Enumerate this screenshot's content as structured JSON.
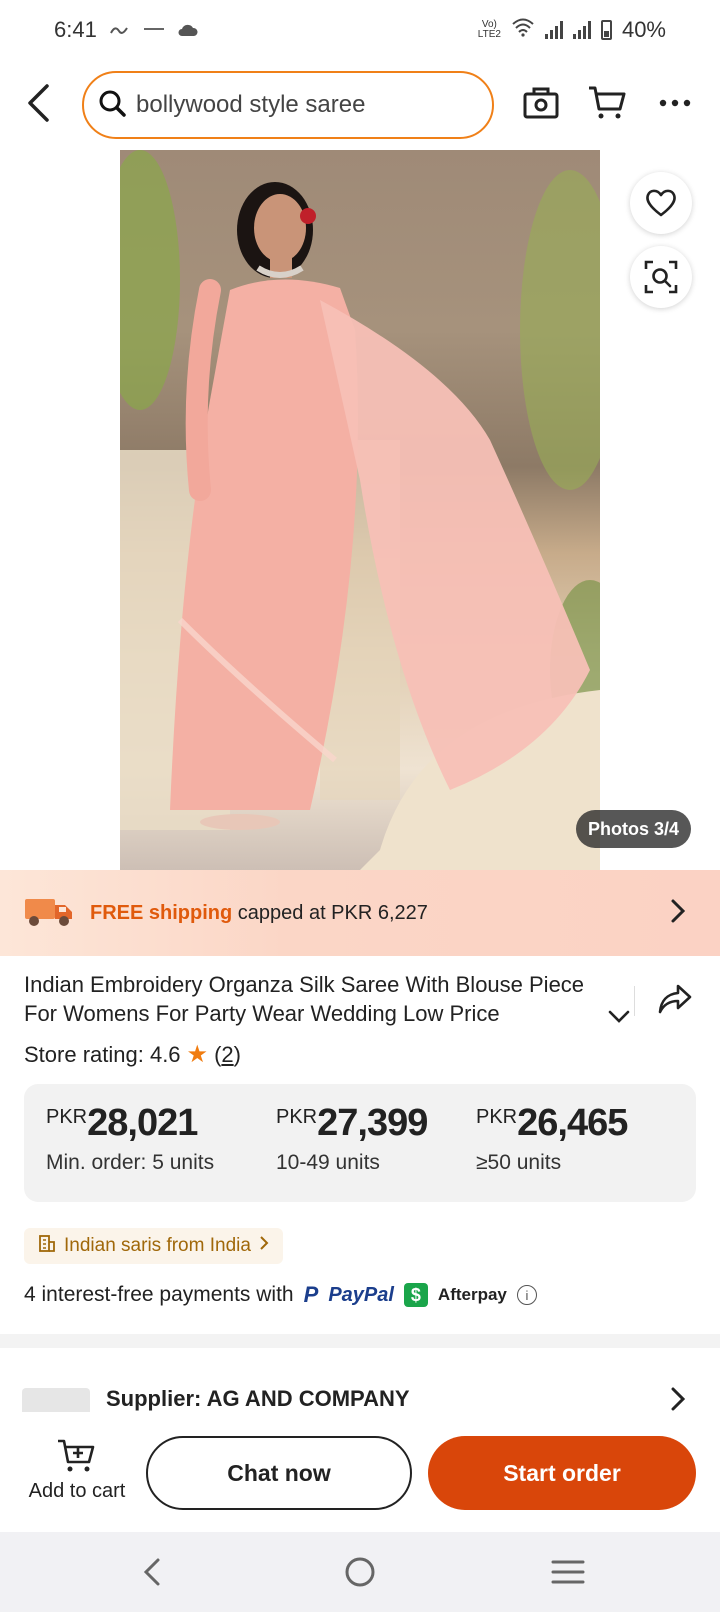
{
  "status_bar": {
    "time": "6:41",
    "battery": "40%",
    "net_label": "LTE2"
  },
  "search": {
    "query": "bollywood style saree"
  },
  "gallery": {
    "photo_counter": "Photos 3/4"
  },
  "shipping": {
    "highlight": "FREE shipping",
    "text": " capped at PKR 6,227"
  },
  "product": {
    "title": "Indian Embroidery Organza Silk Saree With Blouse Piece For Womens For Party Wear Wedding Low Price",
    "rating_label": "Store rating: 4.6",
    "rating_count": "2"
  },
  "price_tiers": [
    {
      "currency": "PKR",
      "amount": "28,021",
      "qty": "Min. order: 5 units"
    },
    {
      "currency": "PKR",
      "amount": "27,399",
      "qty": "10-49 units"
    },
    {
      "currency": "PKR",
      "amount": "26,465",
      "qty": "≥50 units"
    }
  ],
  "tag": {
    "label": "Indian saris from India"
  },
  "payments": {
    "text": "4 interest-free payments with",
    "paypal": "PayPal",
    "afterpay": "Afterpay"
  },
  "supplier": {
    "label": "Supplier:",
    "name": "AG AND COMPANY"
  },
  "actions": {
    "add_to_cart": "Add to cart",
    "chat": "Chat now",
    "start_order": "Start order"
  },
  "colors": {
    "accent_orange": "#d9460a",
    "search_border": "#f08018",
    "shipping_highlight": "#e05a0c",
    "star": "#f07c10"
  }
}
